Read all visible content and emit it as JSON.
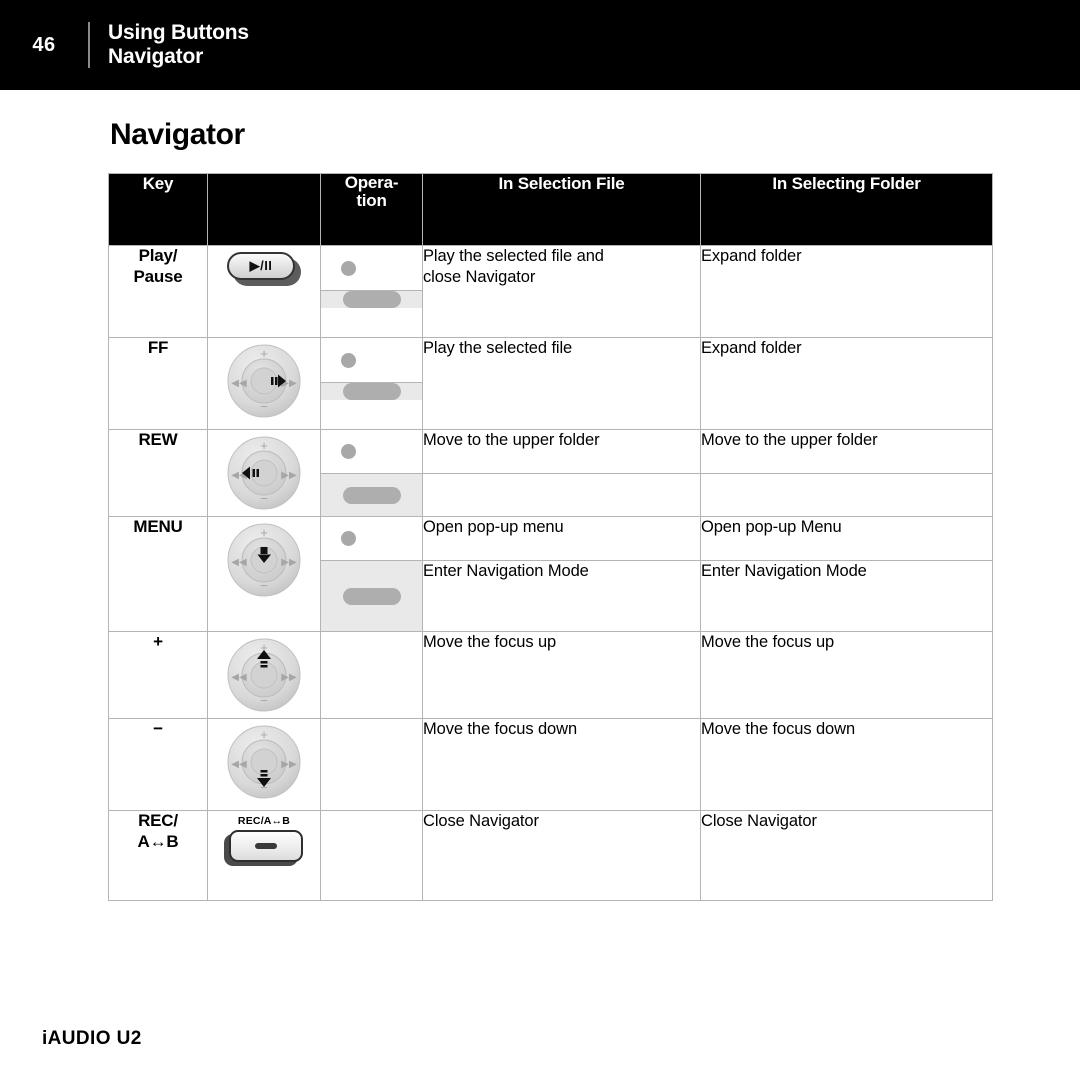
{
  "header": {
    "page_number": "46",
    "title_line1": "Using Buttons",
    "title_line2": "Navigator"
  },
  "page_title": "Navigator",
  "footer": {
    "model": "iAUDIO U2"
  },
  "table": {
    "columns": {
      "key": "Key",
      "icon": "",
      "operation_line1": "Opera-",
      "operation_line2": "tion",
      "in_selection_file": "In Selection File",
      "in_selecting_folder": "In Selecting Folder"
    },
    "rows": [
      {
        "key_line1": "Play/",
        "key_line2": "Pause",
        "icon": "play-pause-button",
        "icon_label": "▶/II",
        "operation_short": true,
        "operation_long": true,
        "file_line1": "Play the selected file and",
        "file_line2": "close Navigator",
        "folder_line1": "Expand folder",
        "folder_line2": "",
        "split_descriptions": false
      },
      {
        "key_line1": "FF",
        "key_line2": "",
        "icon": "wheel-right-arrow",
        "icon_label": "",
        "operation_short": true,
        "operation_long": true,
        "file_line1": "Play the selected file",
        "file_line2": "",
        "folder_line1": "Expand folder",
        "folder_line2": "",
        "split_descriptions": false
      },
      {
        "key_line1": "REW",
        "key_line2": "",
        "icon": "wheel-left-arrow",
        "icon_label": "",
        "operation_short": true,
        "operation_long": true,
        "file_line1": "Move to the upper folder",
        "file_line2": "",
        "folder_line1": "Move to the upper folder",
        "folder_line2": "",
        "split_descriptions": true
      },
      {
        "key_line1": "MENU",
        "key_line2": "",
        "icon": "wheel-center-down-arrow",
        "icon_label": "",
        "operation_short": true,
        "operation_long": true,
        "file_line1": "Open pop-up menu",
        "file_line2": "Enter Navigation Mode",
        "folder_line1": "Open pop-up Menu",
        "folder_line2": "Enter Navigation Mode",
        "split_descriptions": true
      },
      {
        "key_line1": "+",
        "key_line2": "",
        "icon": "wheel-up-arrow",
        "icon_label": "",
        "operation_short": false,
        "operation_long": false,
        "file_line1": "Move the focus up",
        "file_line2": "",
        "folder_line1": "Move the focus up",
        "folder_line2": "",
        "split_descriptions": false
      },
      {
        "key_line1": "−",
        "key_line2": "",
        "icon": "wheel-down-arrow",
        "icon_label": "",
        "operation_short": false,
        "operation_long": false,
        "file_line1": "Move the focus down",
        "file_line2": "",
        "folder_line1": "Move the focus down",
        "folder_line2": "",
        "split_descriptions": false
      },
      {
        "key_line1": "REC/",
        "key_line2": "A↔B",
        "icon": "rec-ab-button",
        "icon_label": "REC/A↔B",
        "operation_short": false,
        "operation_long": false,
        "file_line1": "Close Navigator",
        "file_line2": "",
        "folder_line1": "Close Navigator",
        "folder_line2": "",
        "split_descriptions": false
      }
    ]
  },
  "colors": {
    "header_bar": "#000000",
    "table_border": "#b4b4b4",
    "long_press_cell": "#e9e9e9",
    "press_marker": "#a8a8a8"
  }
}
